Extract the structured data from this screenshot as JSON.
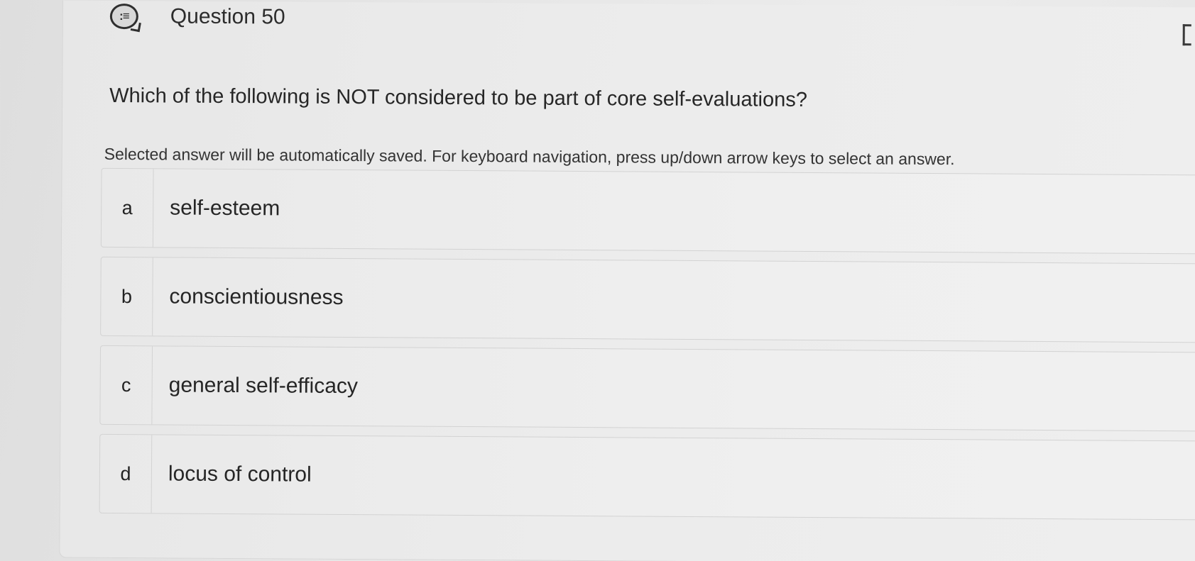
{
  "header": {
    "icon": "list-chat-icon",
    "icon_glyph": ":≡",
    "title": "Question 50"
  },
  "question": {
    "text": "Which of the following is NOT considered to be part of core self-evaluations?",
    "instructions": "Selected answer will be automatically saved. For keyboard navigation, press up/down arrow keys to select an answer."
  },
  "options": [
    {
      "letter": "a",
      "text": "self-esteem"
    },
    {
      "letter": "b",
      "text": "conscientiousness"
    },
    {
      "letter": "c",
      "text": "general self-efficacy"
    },
    {
      "letter": "d",
      "text": "locus of control"
    }
  ],
  "flag": {
    "icon": "flag-icon"
  }
}
